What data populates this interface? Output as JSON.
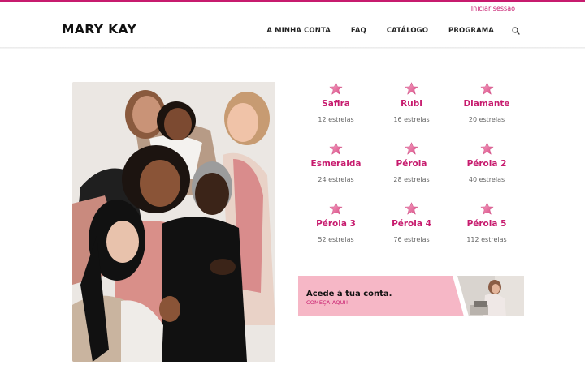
{
  "header": {
    "login_link": "Iniciar sessão",
    "logo": "MARY KAY",
    "nav": [
      "A MINHA CONTA",
      "FAQ",
      "CATÁLOGO",
      "PROGRAMA"
    ],
    "search_icon": "search-icon"
  },
  "levels": [
    {
      "name": "Safira",
      "stars": "12 estrelas"
    },
    {
      "name": "Rubi",
      "stars": "16 estrelas"
    },
    {
      "name": "Diamante",
      "stars": "20 estrelas"
    },
    {
      "name": "Esmeralda",
      "stars": "24 estrelas"
    },
    {
      "name": "Pérola",
      "stars": "28 estrelas"
    },
    {
      "name": "Pérola 2",
      "stars": "40 estrelas"
    },
    {
      "name": "Pérola 3",
      "stars": "52 estrelas"
    },
    {
      "name": "Pérola 4",
      "stars": "76 estrelas"
    },
    {
      "name": "Pérola 5",
      "stars": "112 estrelas"
    }
  ],
  "banner": {
    "title": "Acede à tua conta.",
    "subtitle": "COMEÇA AQUI!"
  },
  "colors": {
    "brand": "#c71b6e",
    "star": "#e7588f",
    "banner": "#f6b7c6"
  }
}
